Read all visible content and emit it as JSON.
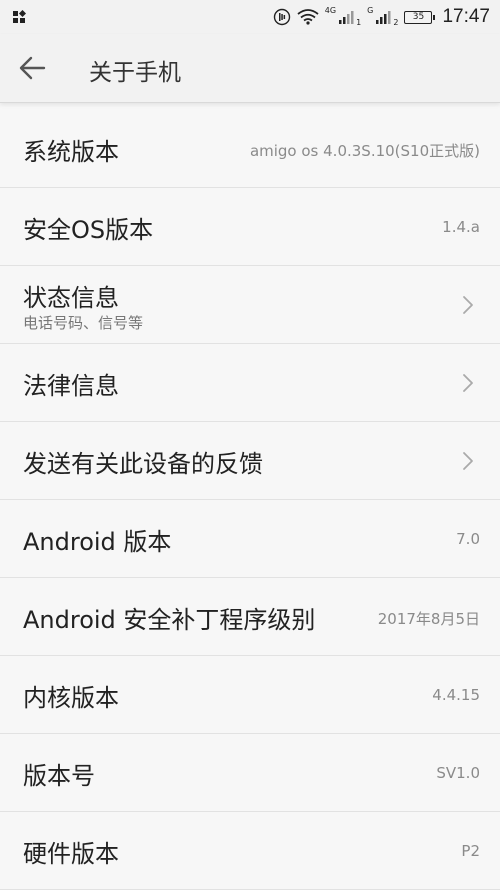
{
  "status_bar": {
    "net_4g": "4G",
    "sim1_sub": "1",
    "net_g": "G",
    "sim2_sub": "2",
    "battery": "35",
    "time": "17:47"
  },
  "app_bar": {
    "title": "关于手机"
  },
  "rows": [
    {
      "title": "系统版本",
      "value": "amigo os 4.0.3S.10(S10正式版)"
    },
    {
      "title": "安全OS版本",
      "value": "1.4.a"
    },
    {
      "title": "状态信息",
      "subtitle": "电话号码、信号等"
    },
    {
      "title": "法律信息"
    },
    {
      "title": "发送有关此设备的反馈"
    },
    {
      "title": "Android 版本",
      "value": "7.0"
    },
    {
      "title": "Android 安全补丁程序级别",
      "value": "2017年8月5日"
    },
    {
      "title": "内核版本",
      "value": "4.4.15"
    },
    {
      "title": "版本号",
      "value": "SV1.0"
    },
    {
      "title": "硬件版本",
      "value": "P2"
    }
  ]
}
